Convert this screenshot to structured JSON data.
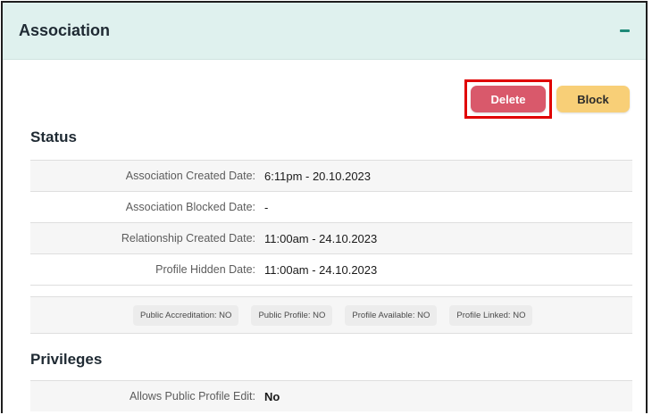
{
  "panel": {
    "title": "Association"
  },
  "actions": {
    "delete_label": "Delete",
    "block_label": "Block"
  },
  "status": {
    "title": "Status",
    "rows": [
      {
        "label": "Association Created Date:",
        "value": "6:11pm - 20.10.2023"
      },
      {
        "label": "Association Blocked Date:",
        "value": "-"
      },
      {
        "label": "Relationship Created Date:",
        "value": "11:00am - 24.10.2023"
      },
      {
        "label": "Profile Hidden Date:",
        "value": "11:00am - 24.10.2023"
      }
    ],
    "chips": [
      "Public Accreditation: NO",
      "Public Profile: NO",
      "Profile Available: NO",
      "Profile Linked: NO"
    ]
  },
  "privileges": {
    "title": "Privileges",
    "rows": [
      {
        "label": "Allows Public Profile Edit:",
        "value": "No"
      }
    ]
  },
  "colors": {
    "header_bg": "#dff1ee",
    "accent": "#1f8a78",
    "delete": "#d9596b",
    "block": "#f8cf77",
    "highlight": "#e00000"
  },
  "icons": {
    "collapse": "minus-icon"
  }
}
